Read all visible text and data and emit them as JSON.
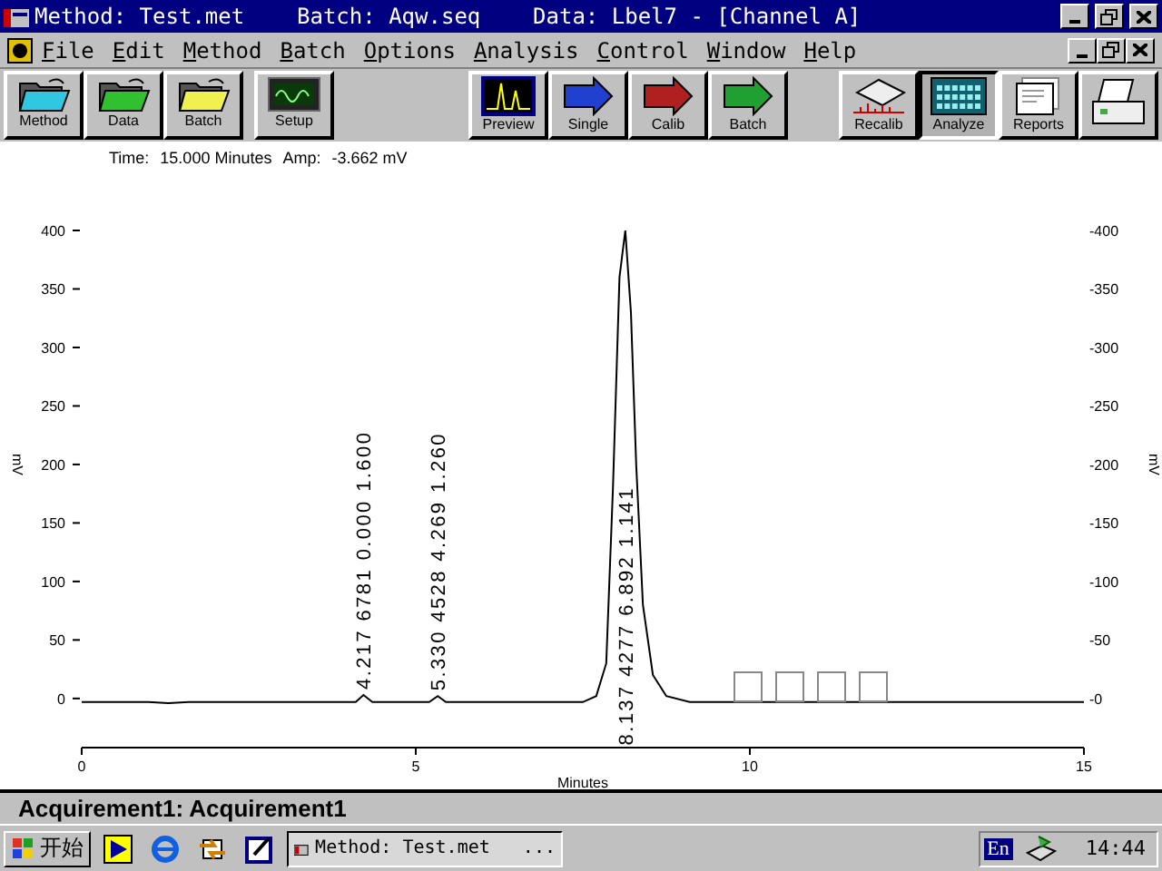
{
  "window": {
    "title": "Method: Test.met    Batch: Aqw.seq    Data: Lbel7 - [Channel A]"
  },
  "menu": [
    "File",
    "Edit",
    "Method",
    "Batch",
    "Options",
    "Analysis",
    "Control",
    "Window",
    "Help"
  ],
  "toolbar": [
    {
      "label": "Method",
      "kind": "folder",
      "color": "#30c8e0",
      "selected": false
    },
    {
      "label": "Data",
      "kind": "folder",
      "color": "#30c030",
      "selected": false
    },
    {
      "label": "Batch",
      "kind": "folder",
      "color": "#f0f050",
      "selected": false
    },
    {
      "label": "Setup",
      "kind": "scope",
      "selected": false
    },
    {
      "label": "Preview",
      "kind": "preview",
      "selected": false
    },
    {
      "label": "Single",
      "kind": "run",
      "color": "#2040d0",
      "selected": false
    },
    {
      "label": "Calib",
      "kind": "run",
      "color": "#b02020",
      "selected": false
    },
    {
      "label": "Batch",
      "kind": "run",
      "color": "#20a030",
      "selected": false
    },
    {
      "label": "Recalib",
      "kind": "recalib",
      "selected": false
    },
    {
      "label": "Analyze",
      "kind": "analyze",
      "selected": true
    },
    {
      "label": "Reports",
      "kind": "reports",
      "selected": false
    },
    {
      "kind": "printer",
      "selected": false
    }
  ],
  "info": [
    {
      "label": "Time:",
      "value": "15.000 Minutes"
    },
    {
      "label": "Amp:",
      "value": "-3.662 mV"
    }
  ],
  "chart": {
    "chart_data": {
      "type": "line",
      "xlabel": "Minutes",
      "ylabel": "mV",
      "xlim": [
        0,
        15
      ],
      "ylim": [
        -42,
        400
      ],
      "xticks": [
        0,
        5,
        10,
        15
      ],
      "yticks": [
        0,
        50,
        100,
        150,
        200,
        250,
        300,
        350,
        400
      ],
      "x": [
        0,
        1,
        1.3,
        1.6,
        4.1,
        4.217,
        4.35,
        5.2,
        5.33,
        5.45,
        7.5,
        7.7,
        7.85,
        7.95,
        8.05,
        8.137,
        8.22,
        8.3,
        8.4,
        8.55,
        8.75,
        9.1,
        15
      ],
      "series": [
        {
          "color": "#000000",
          "values": [
            -3,
            -3,
            -4,
            -3,
            -3,
            3,
            -3,
            -3,
            2,
            -3,
            -3,
            2,
            30,
            180,
            360,
            400,
            330,
            200,
            80,
            20,
            2,
            -3,
            -3
          ]
        }
      ],
      "annotations": [
        "4.217 6781 0.000 1.600",
        "5.330 4528 4.269 1.260",
        "8.137 4277 6.892 1.141"
      ]
    },
    "right_axis": {
      "label": "mV",
      "ticks": [
        "-400",
        "-350",
        "-300",
        "-250",
        "-200",
        "-150",
        "-100",
        "-50",
        "-0"
      ]
    }
  },
  "status_bar": "Acquirement1: Acquirement1",
  "taskbar": {
    "start": "开始",
    "tasks": [
      {
        "label": "Method: Test.met   ...",
        "selected": true
      }
    ],
    "tray": {
      "language": "En",
      "clock": "14:44"
    }
  }
}
